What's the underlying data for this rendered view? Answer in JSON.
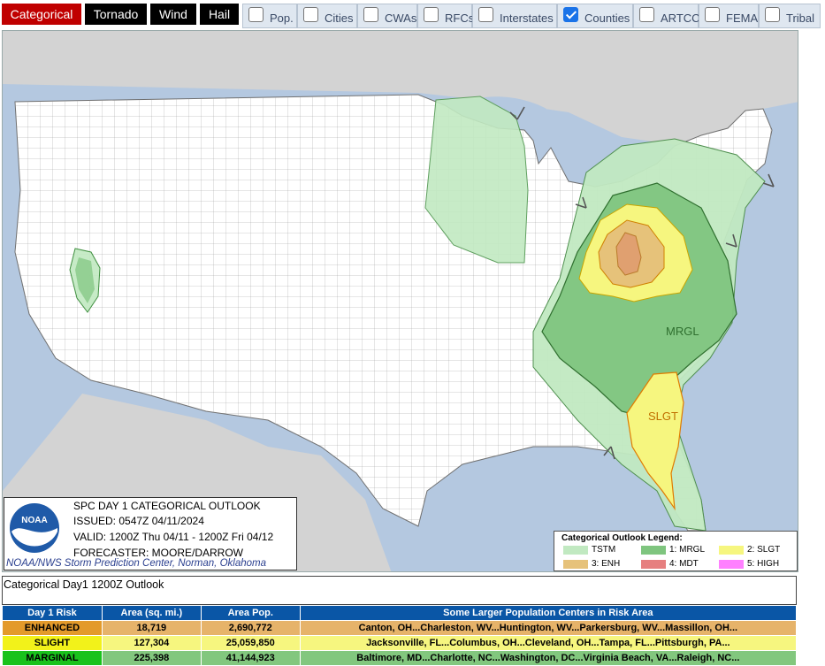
{
  "tabs": [
    {
      "label": "Categorical",
      "active": true
    },
    {
      "label": "Tornado",
      "active": false
    },
    {
      "label": "Wind",
      "active": false
    },
    {
      "label": "Hail",
      "active": false
    }
  ],
  "layers": [
    {
      "label": "Pop.",
      "checked": false
    },
    {
      "label": "Cities",
      "checked": false
    },
    {
      "label": "CWAs",
      "checked": false
    },
    {
      "label": "RFCs",
      "checked": false
    },
    {
      "label": "Interstates",
      "checked": false
    },
    {
      "label": "Counties",
      "checked": true
    },
    {
      "label": "ARTCC",
      "checked": false
    },
    {
      "label": "FEMA",
      "checked": false
    },
    {
      "label": "Tribal",
      "checked": false
    }
  ],
  "map": {
    "labels": {
      "mrgl": "MRGL",
      "slgt": "SLGT"
    },
    "colors": {
      "tstm": "#c1e9c1",
      "mrgl": "#7fc57f",
      "slgt": "#f6f67f",
      "enh": "#e6c27a",
      "mdt": "#e67f7f",
      "high": "#ff80ff",
      "land": "#ffffff",
      "water": "#b4c8e0",
      "foreign": "#d3d3d3"
    }
  },
  "info": {
    "logo_text": "NOAA",
    "title": "SPC DAY 1 CATEGORICAL OUTLOOK",
    "issued": "ISSUED: 0547Z 04/11/2024",
    "valid": "VALID: 1200Z Thu 04/11 - 1200Z Fri 04/12",
    "forecaster": "FORECASTER: MOORE/DARROW",
    "credit": "NOAA/NWS Storm Prediction Center, Norman, Oklahoma"
  },
  "legend": {
    "title": "Categorical Outlook Legend:",
    "items": [
      {
        "label": "TSTM",
        "color": "#c1e9c1"
      },
      {
        "label": "1: MRGL",
        "color": "#7fc57f"
      },
      {
        "label": "2: SLGT",
        "color": "#f6f67f"
      },
      {
        "label": "3: ENH",
        "color": "#e6c27a"
      },
      {
        "label": "4: MDT",
        "color": "#e67f7f"
      },
      {
        "label": "5: HIGH",
        "color": "#ff80ff"
      }
    ]
  },
  "outlook_title": "Categorical Day1 1200Z Outlook",
  "table": {
    "headers": [
      "Day 1 Risk",
      "Area (sq. mi.)",
      "Area Pop.",
      "Some Larger Population Centers in Risk Area"
    ],
    "rows": [
      {
        "risk": "ENHANCED",
        "area": "18,719",
        "pop": "2,690,772",
        "centers": "Canton, OH...Charleston, WV...Huntington, WV...Parkersburg, WV...Massillon, OH..."
      },
      {
        "risk": "SLIGHT",
        "area": "127,304",
        "pop": "25,059,850",
        "centers": "Jacksonville, FL...Columbus, OH...Cleveland, OH...Tampa, FL...Pittsburgh, PA..."
      },
      {
        "risk": "MARGINAL",
        "area": "225,398",
        "pop": "41,144,923",
        "centers": "Baltimore, MD...Charlotte, NC...Washington, DC...Virginia Beach, VA...Raleigh, NC..."
      }
    ]
  }
}
